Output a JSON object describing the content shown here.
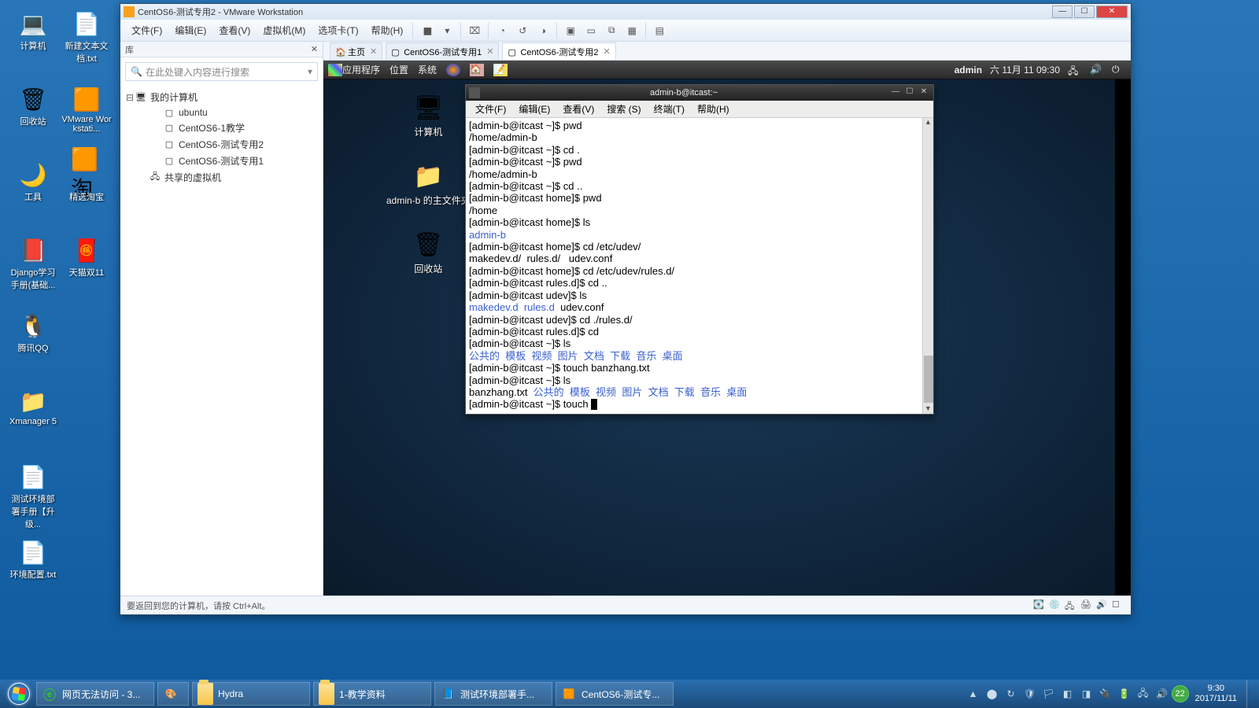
{
  "host_desktop": [
    {
      "label": "计算机",
      "icon": "💻"
    },
    {
      "label": "新建文本文档.txt",
      "icon": "📄"
    },
    {
      "label": "回收站",
      "icon": "🗑"
    },
    {
      "label": "VMware Workstati...",
      "icon": "🟧"
    },
    {
      "label": "工具",
      "icon": "🌙"
    },
    {
      "label": "精选淘宝",
      "icon": "🟧淘"
    },
    {
      "label": "Django学习手册(基础...",
      "icon": "📕"
    },
    {
      "label": "天猫双11",
      "icon": "🧧"
    },
    {
      "label": "腾讯QQ",
      "icon": "🐧"
    },
    {
      "label": "Xmanager 5",
      "icon": "📁"
    },
    {
      "label": "测试环境部署手册【升级...",
      "icon": "📄"
    },
    {
      "label": "环境配置.txt",
      "icon": "📄"
    }
  ],
  "vmware": {
    "title": "CentOS6-测试专用2 - VMware Workstation",
    "menu": [
      "文件(F)",
      "编辑(E)",
      "查看(V)",
      "虚拟机(M)",
      "选项卡(T)",
      "帮助(H)"
    ],
    "sidebar_title": "库",
    "search_placeholder": "在此处键入内容进行搜索",
    "tree_root": "我的计算机",
    "tree": [
      "ubuntu",
      "CentOS6-1教学",
      "CentOS6-测试专用2",
      "CentOS6-测试专用1"
    ],
    "tree_shared": "共享的虚拟机",
    "tabs": [
      {
        "label": "主页",
        "active": false,
        "home": true
      },
      {
        "label": "CentOS6-测试专用1",
        "active": false
      },
      {
        "label": "CentOS6-测试专用2",
        "active": true
      }
    ],
    "status": "要返回到您的计算机，请按 Ctrl+Alt。"
  },
  "gnome": {
    "menu": [
      "应用程序",
      "位置",
      "系统"
    ],
    "user": "admin",
    "date": "六 11月 11 09:30",
    "desktop": [
      {
        "label": "计算机",
        "icon": "🖥"
      },
      {
        "label": "admin-b 的主文件夹",
        "icon": "📁"
      },
      {
        "label": "回收站",
        "icon": "🗑"
      }
    ]
  },
  "terminal": {
    "title": "admin-b@itcast:~",
    "menu": [
      "文件(F)",
      "编辑(E)",
      "查看(V)",
      "搜索 (S)",
      "终端(T)",
      "帮助(H)"
    ],
    "lines": [
      {
        "t": "[admin-b@itcast ~]$ pwd"
      },
      {
        "t": "/home/admin-b"
      },
      {
        "t": "[admin-b@itcast ~]$ cd ."
      },
      {
        "t": "[admin-b@itcast ~]$ pwd"
      },
      {
        "t": "/home/admin-b"
      },
      {
        "t": "[admin-b@itcast ~]$ cd .."
      },
      {
        "t": "[admin-b@itcast home]$ pwd"
      },
      {
        "t": "/home"
      },
      {
        "t": "[admin-b@itcast home]$ ls"
      },
      {
        "t": "admin-b",
        "c": "blue"
      },
      {
        "t": "[admin-b@itcast home]$ cd /etc/udev/"
      },
      {
        "t": "makedev.d/  rules.d/   udev.conf"
      },
      {
        "t": "[admin-b@itcast home]$ cd /etc/udev/rules.d/"
      },
      {
        "t": "[admin-b@itcast rules.d]$ cd .."
      },
      {
        "t": "[admin-b@itcast udev]$ ls"
      },
      {
        "seg": [
          {
            "t": "makedev.d  rules.d",
            "c": "blue"
          },
          {
            "t": "  udev.conf"
          }
        ]
      },
      {
        "t": "[admin-b@itcast udev]$ cd ./rules.d/"
      },
      {
        "t": "[admin-b@itcast rules.d]$ cd"
      },
      {
        "t": "[admin-b@itcast ~]$ ls"
      },
      {
        "seg": [
          {
            "t": "公共的  模板  视频  图片  文档  下载  音乐  桌面",
            "c": "blue"
          }
        ]
      },
      {
        "t": "[admin-b@itcast ~]$ touch banzhang.txt"
      },
      {
        "t": "[admin-b@itcast ~]$ ls"
      },
      {
        "seg": [
          {
            "t": "banzhang.txt  "
          },
          {
            "t": "公共的  模板  视频  图片  文档  下载  音乐  桌面",
            "c": "blue"
          }
        ]
      },
      {
        "seg": [
          {
            "t": "[admin-b@itcast ~]$ touch "
          }
        ],
        "cursor": true
      }
    ]
  },
  "taskbar": {
    "buttons": [
      {
        "label": "网页无法访问 - 3...",
        "icon": "e"
      },
      {
        "label": "",
        "icon": "🎨",
        "small": true
      },
      {
        "label": "Hydra",
        "icon": "folder"
      },
      {
        "label": "1-教学资料",
        "icon": "folder"
      },
      {
        "label": "测试环境部署手...",
        "icon": "📘"
      },
      {
        "label": "CentOS6-测试专...",
        "icon": "🟧"
      }
    ],
    "green_badge": "22",
    "time": "9:30",
    "date": "2017/11/11"
  }
}
